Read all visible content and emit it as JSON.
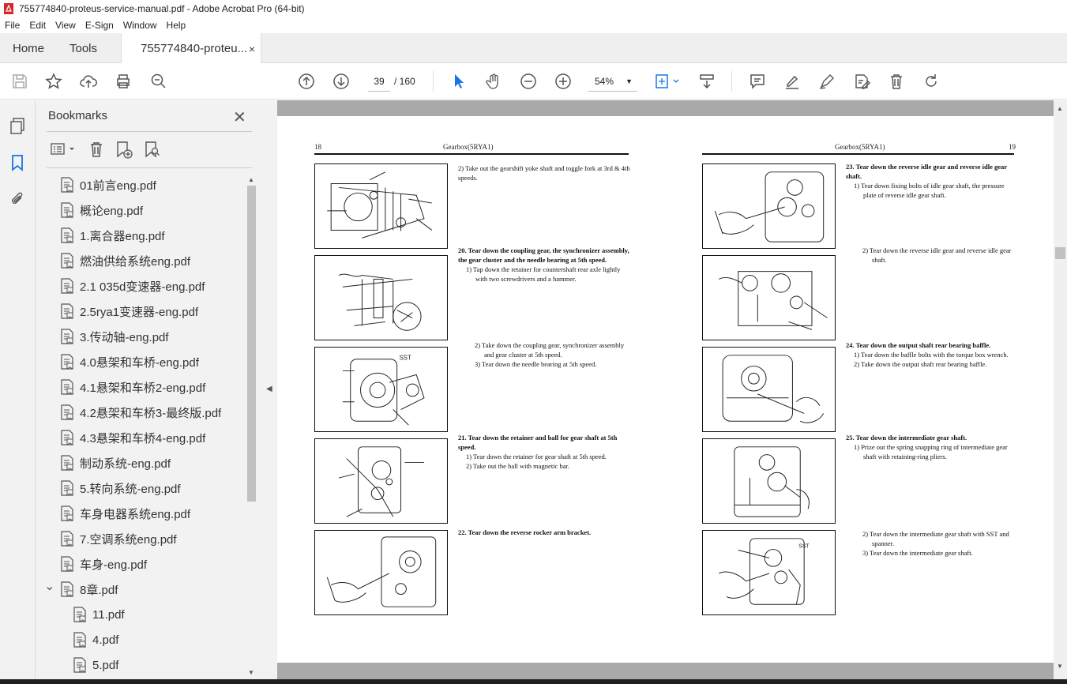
{
  "window": {
    "title": "755774840-proteus-service-manual.pdf - Adobe Acrobat Pro (64-bit)"
  },
  "menu": [
    "File",
    "Edit",
    "View",
    "E-Sign",
    "Window",
    "Help"
  ],
  "tabs": {
    "home": "Home",
    "tools": "Tools",
    "doc": "755774840-proteu...",
    "close": "×"
  },
  "toolbar": {
    "page_current": "39",
    "page_total": "/ 160",
    "zoom": "54%"
  },
  "bookmarks": {
    "title": "Bookmarks",
    "items": [
      {
        "label": "01前言eng.pdf"
      },
      {
        "label": "概论eng.pdf"
      },
      {
        "label": "1.离合器eng.pdf"
      },
      {
        "label": "燃油供给系统eng.pdf"
      },
      {
        "label": "2.1 035d变速器-eng.pdf"
      },
      {
        "label": "2.5rya1变速器-eng.pdf"
      },
      {
        "label": "3.传动轴-eng.pdf"
      },
      {
        "label": "4.0悬架和车桥-eng.pdf"
      },
      {
        "label": "4.1悬架和车桥2-eng.pdf"
      },
      {
        "label": "4.2悬架和车桥3-最终版.pdf"
      },
      {
        "label": "4.3悬架和车桥4-eng.pdf"
      },
      {
        "label": "制动系统-eng.pdf"
      },
      {
        "label": "5.转向系统-eng.pdf"
      },
      {
        "label": "车身电器系统eng.pdf"
      },
      {
        "label": "7.空调系统eng.pdf"
      },
      {
        "label": "车身-eng.pdf"
      },
      {
        "label": "8章.pdf"
      },
      {
        "label": "11.pdf"
      },
      {
        "label": "4.pdf"
      },
      {
        "label": "5.pdf"
      }
    ]
  },
  "document": {
    "left": {
      "page_no": "18",
      "header": "Gearbox(5RYA1)",
      "p1": "2)  Take out the gearshift yoke shaft and toggle fork at 3rd & 4th speeds.",
      "s20_title": "20.  Tear down the coupling gear, the synchronizer assembly, the gear cluster and the needle bearing at 5th speed.",
      "s20_1": "1)  Tap down the retainer for countershaft rear axle lightly with two screwdrivers and a hammer.",
      "s20_2": "2)  Take down the coupling gear, synchronizer assembly and gear cluster at 5th speed.",
      "s20_3": "3)  Tear down the needle bearing at 5th speed.",
      "sst": "SST",
      "s21_title": "21.  Tear down the retainer and ball for gear shaft at 5th speed.",
      "s21_1": "1)  Tear down the retainer for gear shaft at 5th speed.",
      "s21_2": "2)  Take out the ball with magnetic bar.",
      "s22_title": "22.  Tear down the reverse rocker arm bracket."
    },
    "right": {
      "page_no": "19",
      "header": "Gearbox(5RYA1)",
      "s23_title": "23.  Tear down the reverse idle gear and reverse idle gear shaft.",
      "s23_1": "1)  Tear down fixing bolts of idle gear shaft, the pressure plate of reverse idle gear shaft.",
      "s23_2": "2)  Tear down the reverse idle gear and reverse idle gear shaft.",
      "s24_title": "24.  Tear down the output shaft rear bearing baffle.",
      "s24_1": "1)  Tear down the baffle bolts with the torque box wrench.",
      "s24_2": "2)  Take down the output shaft rear bearing baffle.",
      "s25_title": "25.  Tear down the intermediate gear shaft.",
      "s25_1": "1)  Prize out the spring snapping ring of intermediate gear shaft with retaining-ring pliers.",
      "s25_2": "2)  Tear down the intermediate gear shaft with SST and spanner.",
      "s25_3": "3)  Tear down the intermediate gear shaft.",
      "sst": "SST"
    }
  }
}
